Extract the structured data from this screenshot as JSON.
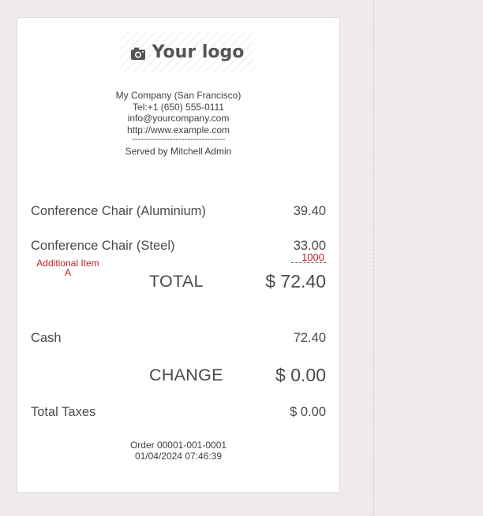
{
  "receipt": {
    "logo_text": "Your logo",
    "logo_icon": "camera-icon",
    "company_name": "My Company (San Francisco)",
    "phone": "Tel:+1 (650) 555-0111",
    "email": "info@yourcompany.com",
    "website": "http://www.example.com",
    "separator": "--------------------------------",
    "served_by": "Served by Mitchell Admin",
    "items": [
      {
        "name": "Conference Chair (Aluminium)",
        "amount": "39.40"
      },
      {
        "name": "Conference Chair (Steel)",
        "amount": "33.00"
      }
    ],
    "annotation": {
      "label": "Additional Item A",
      "value": "1000",
      "color": "#c21f1f"
    },
    "total_label": "TOTAL",
    "total_amount": "$ 72.40",
    "payment_method": "Cash",
    "payment_amount": "72.40",
    "change_label": "CHANGE",
    "change_amount": "$ 0.00",
    "taxes_label": "Total Taxes",
    "taxes_amount": "$ 0.00",
    "order_number": "Order 00001-001-0001",
    "order_datetime": "01/04/2024 07:46:39"
  }
}
